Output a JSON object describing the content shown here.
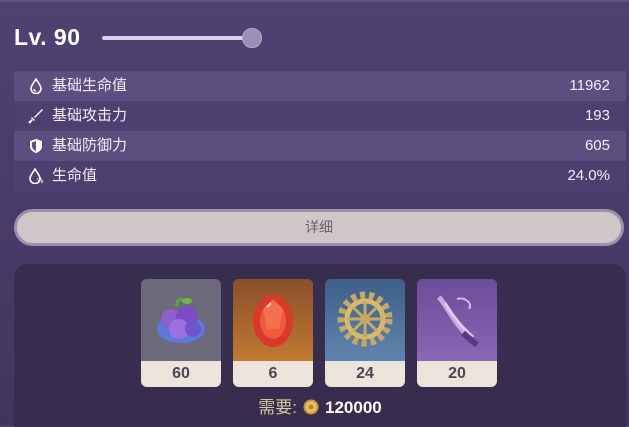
{
  "header": {
    "level_text": "Lv. 90",
    "level_slider_value": 1.0
  },
  "stats": [
    {
      "icon": "hp-drop-icon",
      "label": "基础生命值",
      "value": "11962"
    },
    {
      "icon": "sword-icon",
      "label": "基础攻击力",
      "value": "193"
    },
    {
      "icon": "shield-icon",
      "label": "基础防御力",
      "value": "605"
    },
    {
      "icon": "hp-percent-icon",
      "label": "生命值",
      "value": "24.0%"
    }
  ],
  "detail_button": {
    "label": "详细"
  },
  "materials": [
    {
      "icon": "purple-berry-icon",
      "count": "60",
      "rarity_color": "#6c6a7a"
    },
    {
      "icon": "red-gem-icon",
      "count": "6",
      "rarity_color": "#b46a2c"
    },
    {
      "icon": "gear-icon",
      "count": "24",
      "rarity_color": "#4b6f9a"
    },
    {
      "icon": "feather-icon",
      "count": "20",
      "rarity_color": "#7b5aa8"
    }
  ],
  "cost": {
    "label": "需要:",
    "icon": "mora-coin-icon",
    "value": "120000"
  }
}
